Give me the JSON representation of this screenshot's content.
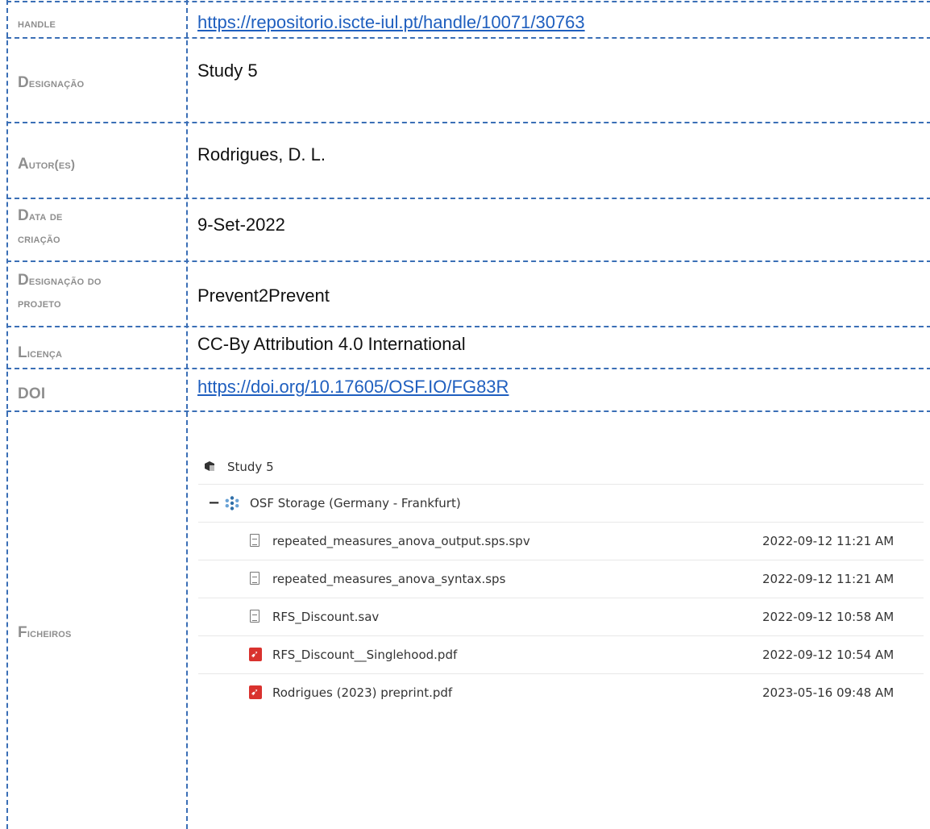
{
  "rows": {
    "handle": {
      "label": "handle",
      "value": "https://repositorio.iscte-iul.pt/handle/10071/30763"
    },
    "designacao": {
      "label_big": "D",
      "label_sc": "esignação",
      "value": "Study 5"
    },
    "autores": {
      "label_big": "A",
      "label_sc": "utor(es)",
      "value": "Rodrigues, D. L."
    },
    "data": {
      "label_big": "D",
      "label_line1": "ata de",
      "label_line2": "criação",
      "value": "9-Set-2022"
    },
    "projeto": {
      "label_big": "D",
      "label_line1": "esignação do",
      "label_line2": "projeto",
      "value": "Prevent2Prevent"
    },
    "licenca": {
      "label_big": "L",
      "label_sc": "icença",
      "value": "CC-By Attribution 4.0 International"
    },
    "doi": {
      "label": "DOI",
      "value": "https://doi.org/10.17605/OSF.IO/FG83R"
    },
    "ficheiros": {
      "label_big": "F",
      "label_sc": "icheiros"
    }
  },
  "osf": {
    "project": {
      "name": "Study 5",
      "icon": "cube-icon"
    },
    "storage": {
      "name": "OSF Storage (Germany - Frankfurt)",
      "icon": "osf-storage-icon",
      "collapse": "−"
    },
    "files": [
      {
        "name": "repeated_measures_anova_output.sps.spv",
        "date": "2022-09-12 11:21 AM",
        "icon": "file-icon"
      },
      {
        "name": "repeated_measures_anova_syntax.sps",
        "date": "2022-09-12 11:21 AM",
        "icon": "file-icon"
      },
      {
        "name": "RFS_Discount.sav",
        "date": "2022-09-12 10:58 AM",
        "icon": "file-icon"
      },
      {
        "name": "RFS_Discount__Singlehood.pdf",
        "date": "2022-09-12 10:54 AM",
        "icon": "pdf-icon"
      },
      {
        "name": "Rodrigues (2023) preprint.pdf",
        "date": "2023-05-16 09:48 AM",
        "icon": "pdf-icon"
      }
    ]
  }
}
